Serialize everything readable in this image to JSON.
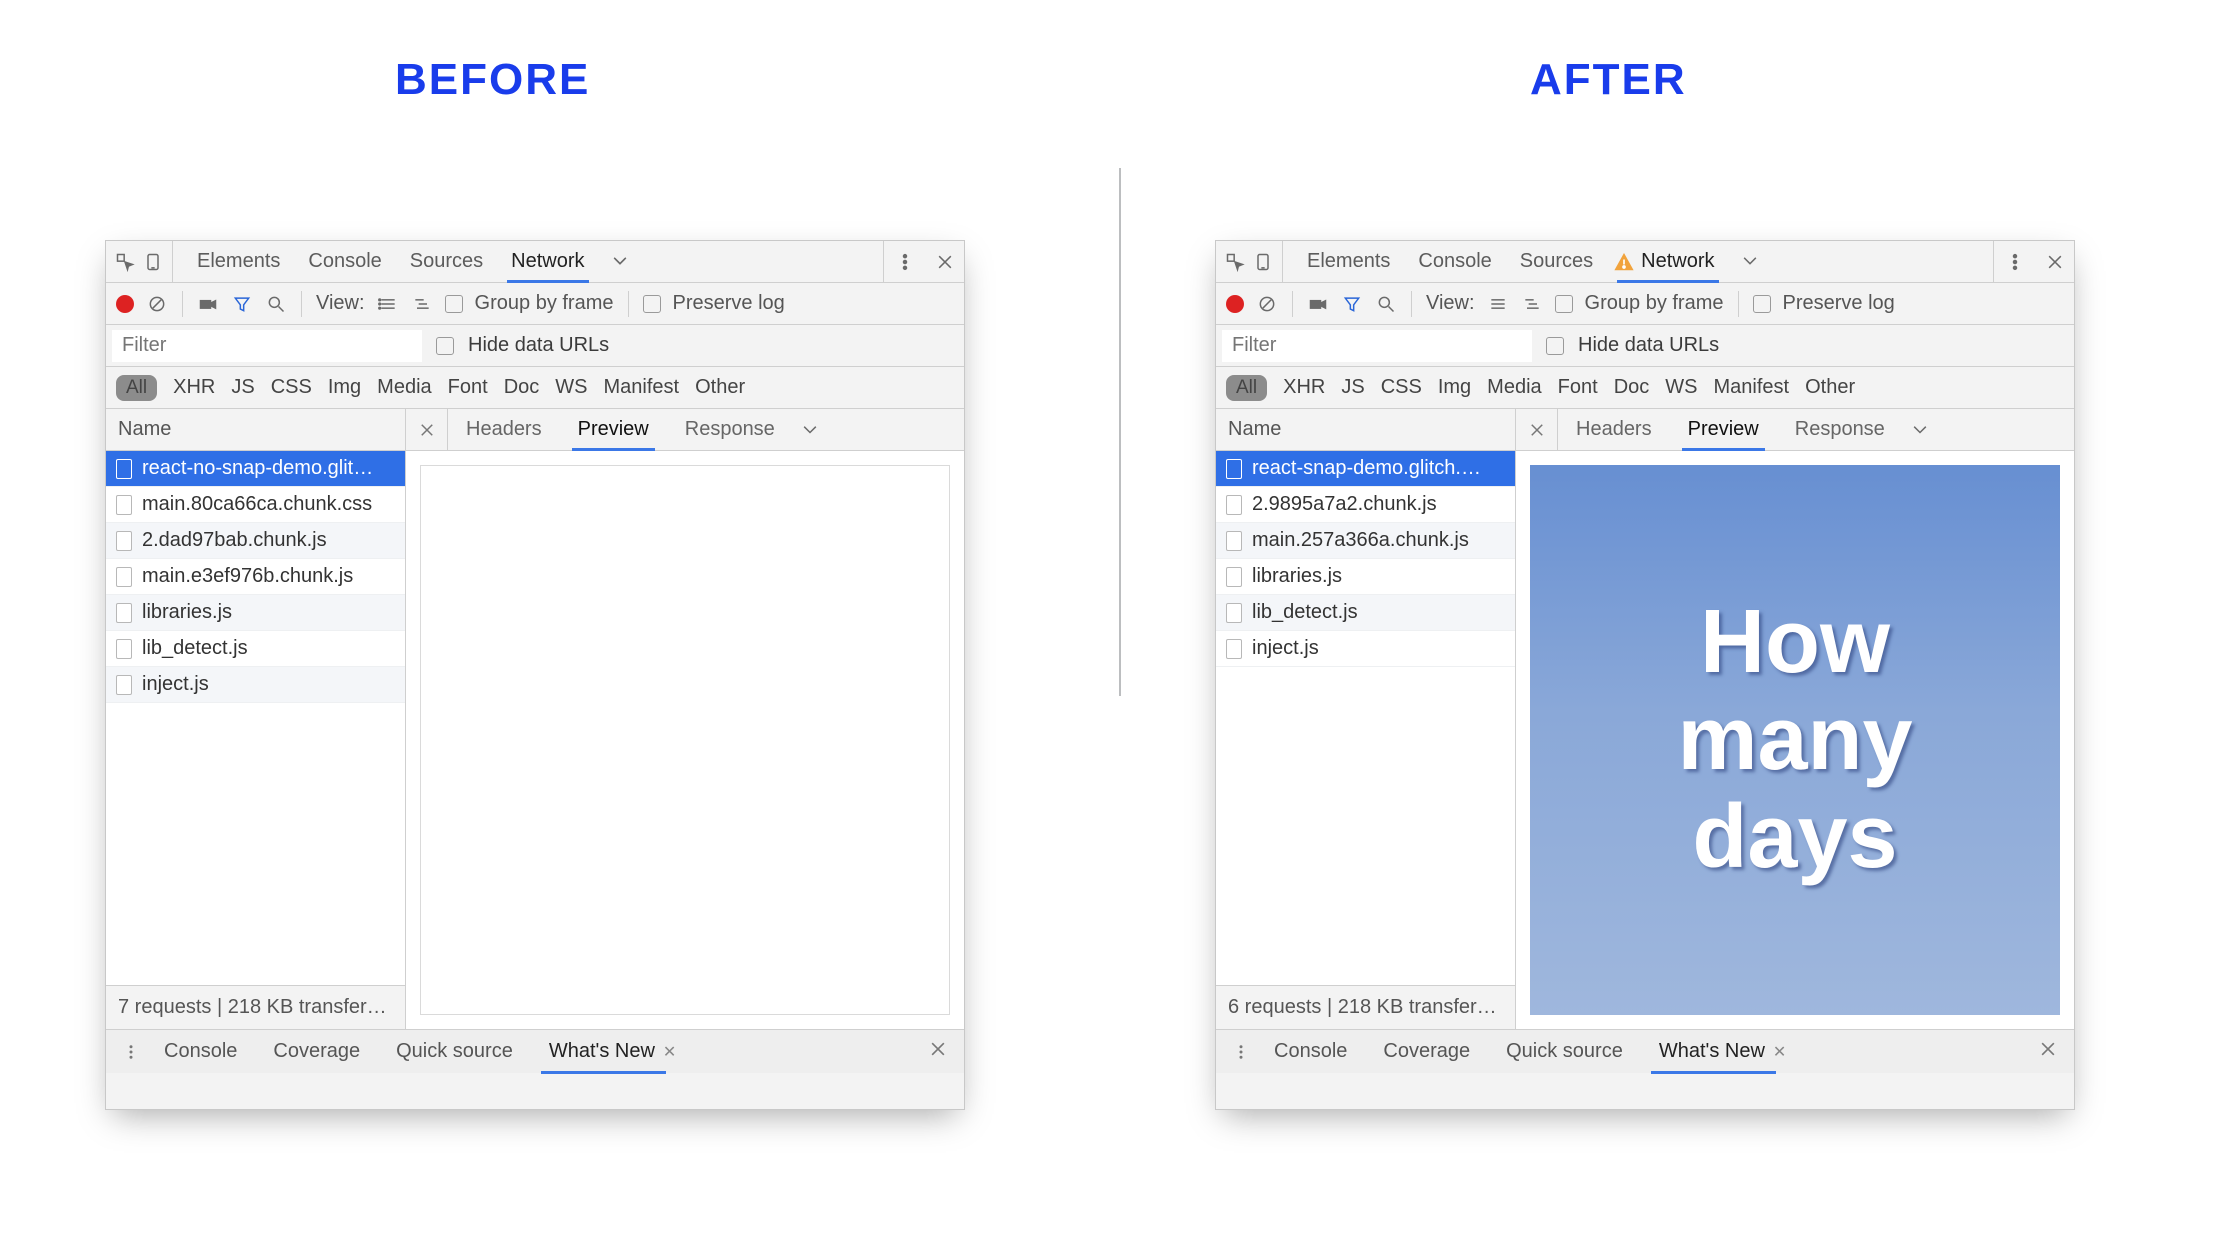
{
  "headings": {
    "before": "BEFORE",
    "after": "AFTER"
  },
  "tabs": {
    "elements": "Elements",
    "console": "Console",
    "sources": "Sources",
    "network": "Network"
  },
  "toolbar": {
    "view": "View:",
    "group": "Group by frame",
    "preserve": "Preserve log"
  },
  "filter": {
    "placeholder": "Filter",
    "hide": "Hide data URLs"
  },
  "types": {
    "all": "All",
    "xhr": "XHR",
    "js": "JS",
    "css": "CSS",
    "img": "Img",
    "media": "Media",
    "font": "Font",
    "doc": "Doc",
    "ws": "WS",
    "manifest": "Manifest",
    "other": "Other"
  },
  "cols": {
    "name": "Name",
    "headers": "Headers",
    "preview": "Preview",
    "response": "Response"
  },
  "before": {
    "requests": [
      "react-no-snap-demo.glit…",
      "main.80ca66ca.chunk.css",
      "2.dad97bab.chunk.js",
      "main.e3ef976b.chunk.js",
      "libraries.js",
      "lib_detect.js",
      "inject.js"
    ],
    "status": "7 requests | 218 KB transfer…"
  },
  "after": {
    "requests": [
      "react-snap-demo.glitch.…",
      "2.9895a7a2.chunk.js",
      "main.257a366a.chunk.js",
      "libraries.js",
      "lib_detect.js",
      "inject.js"
    ],
    "status": "6 requests | 218 KB transfer…",
    "preview": {
      "l1": "How",
      "l2": "many",
      "l3": "days"
    }
  },
  "drawer": {
    "console": "Console",
    "coverage": "Coverage",
    "quick": "Quick source",
    "whatsnew": "What's New"
  }
}
